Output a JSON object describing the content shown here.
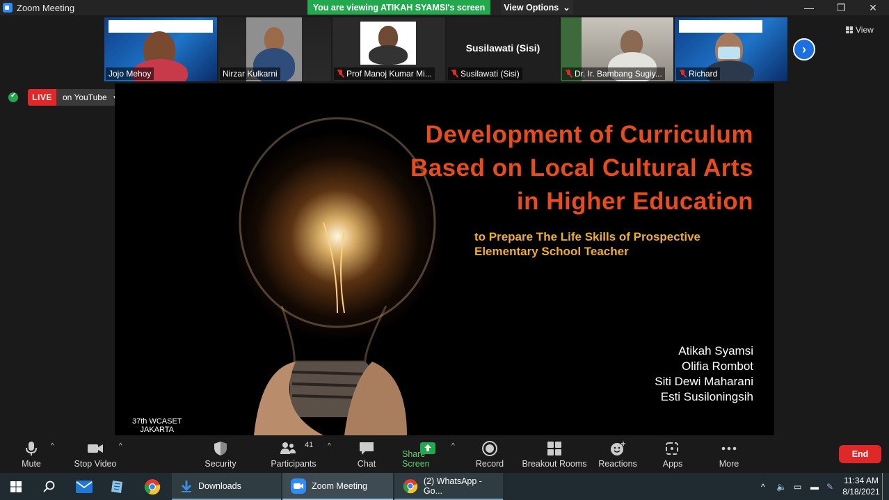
{
  "window": {
    "title": "Zoom Meeting",
    "viewing_banner": "You are viewing ATIKAH SYAMSI's screen",
    "view_options": "View Options",
    "view_label": "View"
  },
  "participants": [
    {
      "name": "Jojo Mehoy",
      "muted": false,
      "active": true
    },
    {
      "name": "Nirzar Kulkarni",
      "muted": false,
      "active": false
    },
    {
      "name": "Prof Manoj Kumar Mi...",
      "muted": true,
      "active": false
    },
    {
      "name": "Susilawati (Sisi)",
      "muted": true,
      "active": false,
      "display_name": "Susilawati (Sisi)"
    },
    {
      "name": "Dr. Ir. Bambang Sugiy...",
      "muted": true,
      "active": false
    },
    {
      "name": "Richard",
      "muted": true,
      "active": false
    }
  ],
  "live": {
    "badge": "LIVE",
    "platform": "on YouTube"
  },
  "slide": {
    "title_lines": [
      "Development of Curriculum",
      "Based on Local Cultural Arts",
      "in Higher Education"
    ],
    "subtitle_lines": [
      "to Prepare The Life Skills of Prospective",
      "Elementary School Teacher"
    ],
    "authors": [
      "Atikah Syamsi",
      "Olifia Rombot",
      "Siti Dewi Maharani",
      "Esti Susiloningsih"
    ],
    "conference_lines": [
      "37th WCASET",
      "JAKARTA"
    ],
    "colors": {
      "title": "#e84b1c",
      "subtitle": "#f2b01e"
    }
  },
  "toolbar": {
    "mute": "Mute",
    "stop_video": "Stop Video",
    "security": "Security",
    "participants": "Participants",
    "participants_count": "41",
    "chat": "Chat",
    "share_screen": "Share Screen",
    "record": "Record",
    "breakout_rooms": "Breakout Rooms",
    "reactions": "Reactions",
    "apps": "Apps",
    "more": "More",
    "end": "End"
  },
  "taskbar": {
    "apps": [
      "Downloads",
      "Zoom Meeting",
      "(2) WhatsApp - Go..."
    ],
    "time": "11:34 AM",
    "date": "8/18/2021"
  }
}
